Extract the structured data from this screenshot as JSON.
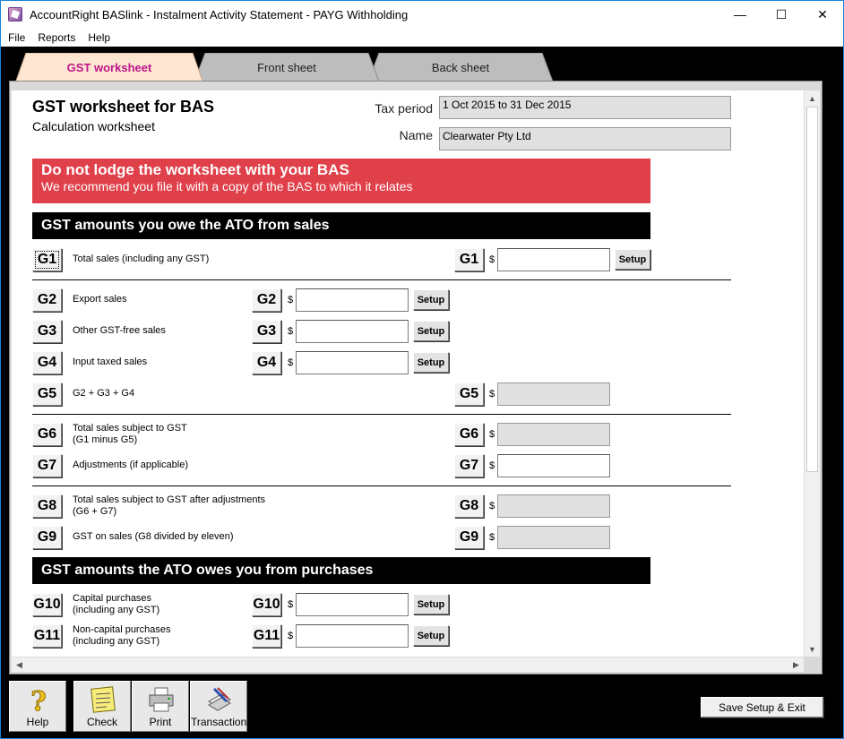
{
  "window": {
    "title": "AccountRight BASlink - Instalment Activity Statement - PAYG Withholding",
    "minimize": "—",
    "maximize": "☐",
    "close": "✕"
  },
  "menu": [
    "File",
    "Reports",
    "Help"
  ],
  "tabs": [
    "GST worksheet",
    "Front sheet",
    "Back sheet"
  ],
  "header": {
    "title": "GST worksheet for BAS",
    "subtitle": "Calculation worksheet",
    "tax_period_label": "Tax period",
    "tax_period_value": "1 Oct 2015 to 31 Dec 2015",
    "name_label": "Name",
    "name_value": "Clearwater Pty Ltd"
  },
  "warning": {
    "line1": "Do not lodge the worksheet with your BAS",
    "line2": "We recommend you file it with a copy of the BAS to which it relates"
  },
  "section_sales": "GST amounts you owe the ATO from sales",
  "section_purchases": "GST amounts the ATO owes you from purchases",
  "dollar": "$",
  "setup_label": "Setup",
  "rows": {
    "G1": {
      "code": "G1",
      "label": "Total sales (including any GST)"
    },
    "G2": {
      "code": "G2",
      "label": "Export sales"
    },
    "G3": {
      "code": "G3",
      "label": "Other GST-free sales"
    },
    "G4": {
      "code": "G4",
      "label": "Input taxed sales"
    },
    "G5": {
      "code": "G5",
      "label": "G2 + G3 + G4"
    },
    "G6": {
      "code": "G6",
      "label1": "Total sales subject to GST",
      "label2": "(G1 minus G5)"
    },
    "G7": {
      "code": "G7",
      "label": "Adjustments (if applicable)"
    },
    "G8": {
      "code": "G8",
      "label1": "Total sales subject to GST after adjustments",
      "label2": "(G6 + G7)"
    },
    "G9": {
      "code": "G9",
      "label": "GST on sales (G8 divided by eleven)"
    },
    "G10": {
      "code": "G10",
      "label1": "Capital purchases",
      "label2": "(including any GST)"
    },
    "G11": {
      "code": "G11",
      "label1": "Non-capital purchases",
      "label2": "(including any GST)"
    }
  },
  "toolbar": {
    "help": "Help",
    "check": "Check",
    "print": "Print",
    "transaction": "Transaction",
    "save_exit": "Save Setup & Exit"
  }
}
